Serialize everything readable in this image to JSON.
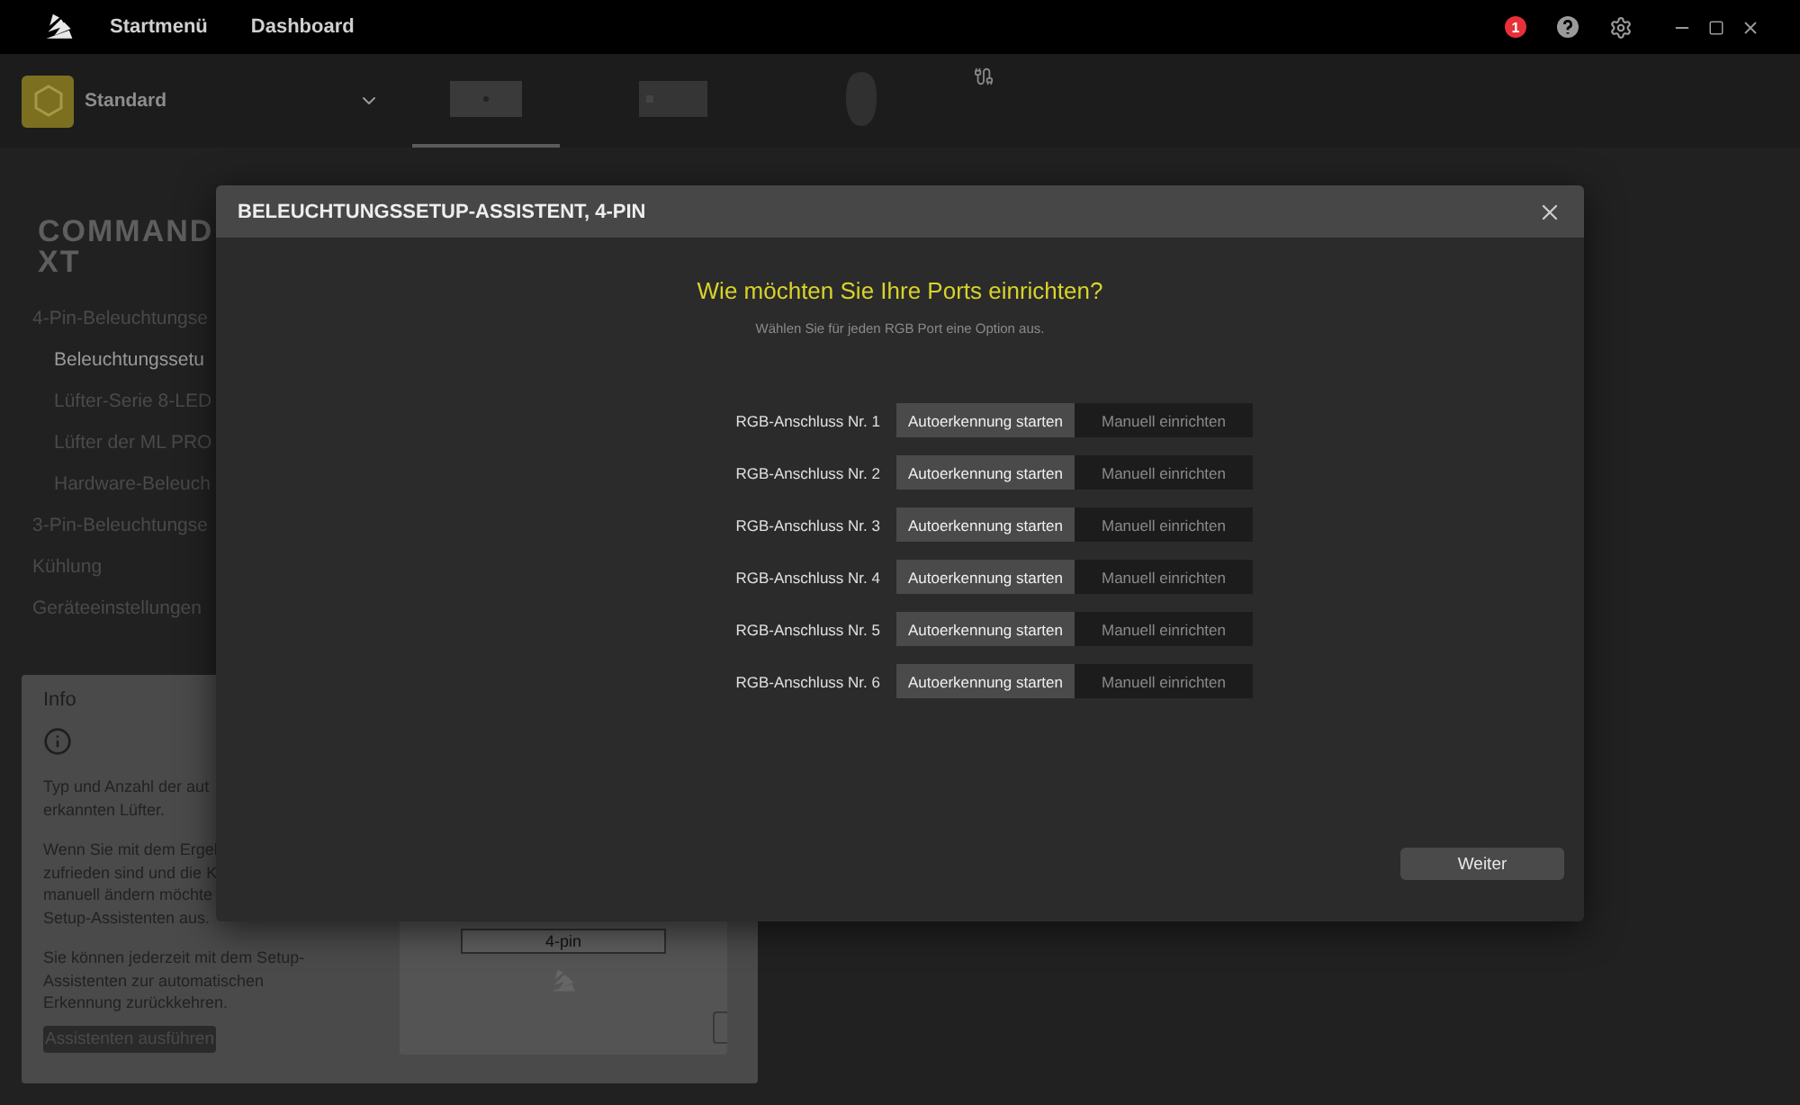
{
  "top_nav": [
    {
      "label": "Startmenü"
    },
    {
      "label": "Dashboard"
    }
  ],
  "notifications": {
    "count": "1"
  },
  "profile": {
    "name": "Standard"
  },
  "devices": [
    {
      "kind": "controller",
      "selected": true
    },
    {
      "kind": "hub",
      "selected": false
    },
    {
      "kind": "mouse",
      "selected": false
    }
  ],
  "device_title": [
    "COMMAND",
    "XT"
  ],
  "sidebar": {
    "items": [
      {
        "label": "4-Pin-Beleuchtungse",
        "selected": false,
        "children": [
          {
            "label": "Beleuchtungssetu",
            "selected": true
          },
          {
            "label": "Lüfter-Serie 8-LED",
            "selected": false
          },
          {
            "label": "Lüfter der ML PRO",
            "selected": false
          },
          {
            "label": "Hardware-Beleuch",
            "selected": false
          }
        ]
      },
      {
        "label": "3-Pin-Beleuchtungse",
        "selected": false
      },
      {
        "label": "Kühlung",
        "selected": false
      },
      {
        "label": "Geräteeinstellungen",
        "selected": false
      }
    ]
  },
  "info": {
    "title": "Info",
    "paragraphs": [
      [
        "Typ und Anzahl der aut",
        "erkannten Lüfter."
      ],
      [
        "Wenn Sie mit dem Ergel",
        "zufrieden sind und die K",
        "manuell ändern möchte",
        "Setup-Assistenten aus."
      ],
      [
        "Sie können jederzeit mit dem Setup-",
        "Assistenten zur automatischen",
        "Erkennung zurückkehren."
      ]
    ],
    "button": "Assistenten ausführen",
    "preview_label": "4-pin"
  },
  "dialog": {
    "title": "BELEUCHTUNGSSETUP-ASSISTENT, 4-PIN",
    "heading": "Wie möchten Sie Ihre Ports einrichten?",
    "subtitle": "Wählen Sie für jeden RGB Port eine Option aus.",
    "ports": [
      {
        "label": "RGB-Anschluss Nr. 1",
        "options": [
          {
            "label": "Autoerkennung starten",
            "selected": true
          },
          {
            "label": "Manuell einrichten",
            "selected": false
          }
        ]
      },
      {
        "label": "RGB-Anschluss Nr. 2",
        "options": [
          {
            "label": "Autoerkennung starten",
            "selected": true
          },
          {
            "label": "Manuell einrichten",
            "selected": false
          }
        ]
      },
      {
        "label": "RGB-Anschluss Nr. 3",
        "options": [
          {
            "label": "Autoerkennung starten",
            "selected": true
          },
          {
            "label": "Manuell einrichten",
            "selected": false
          }
        ]
      },
      {
        "label": "RGB-Anschluss Nr. 4",
        "options": [
          {
            "label": "Autoerkennung starten",
            "selected": true
          },
          {
            "label": "Manuell einrichten",
            "selected": false
          }
        ]
      },
      {
        "label": "RGB-Anschluss Nr. 5",
        "options": [
          {
            "label": "Autoerkennung starten",
            "selected": true
          },
          {
            "label": "Manuell einrichten",
            "selected": false
          }
        ]
      },
      {
        "label": "RGB-Anschluss Nr. 6",
        "options": [
          {
            "label": "Autoerkennung starten",
            "selected": true
          },
          {
            "label": "Manuell einrichten",
            "selected": false
          }
        ]
      }
    ],
    "next_button": "Weiter"
  }
}
